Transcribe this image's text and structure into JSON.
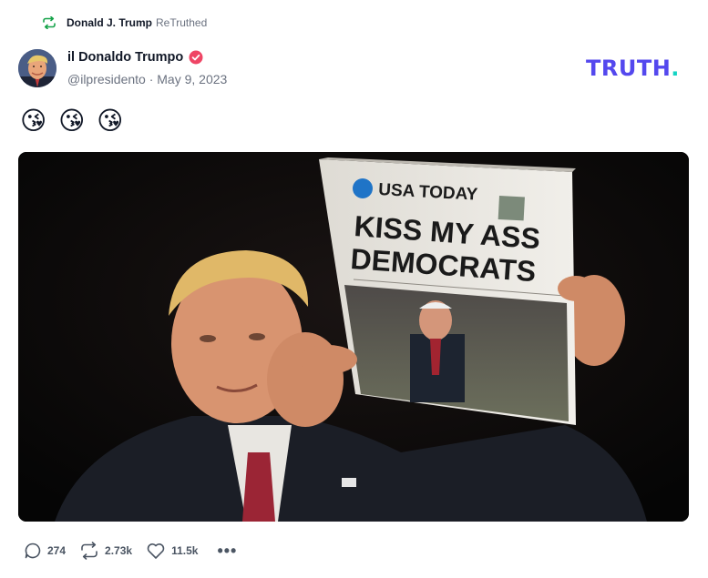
{
  "retruth": {
    "user_name": "Donald J. Trump",
    "action_label": "ReTruthed",
    "icon": "retruth-icon"
  },
  "post": {
    "author": {
      "display_name": "il Donaldo Trumpo",
      "handle": "@ilpresidento",
      "date": "May 9, 2023",
      "verified": true
    },
    "text": "😘 😘 😘",
    "image": {
      "headline_line1": "KISS MY ASS",
      "headline_line2": "DEMOCRATS",
      "masthead": "USA TODAY"
    }
  },
  "brand": {
    "name": "TRUTH",
    "dot": ".",
    "color": "#5448ee",
    "dot_color": "#14d4c4"
  },
  "actions": {
    "replies": "274",
    "retruths": "2.73k",
    "likes": "11.5k",
    "more_label": "•••"
  },
  "colors": {
    "retruth_icon": "#16a34a",
    "verified_badge": "#ef4565",
    "meta_text": "#6b7280"
  }
}
